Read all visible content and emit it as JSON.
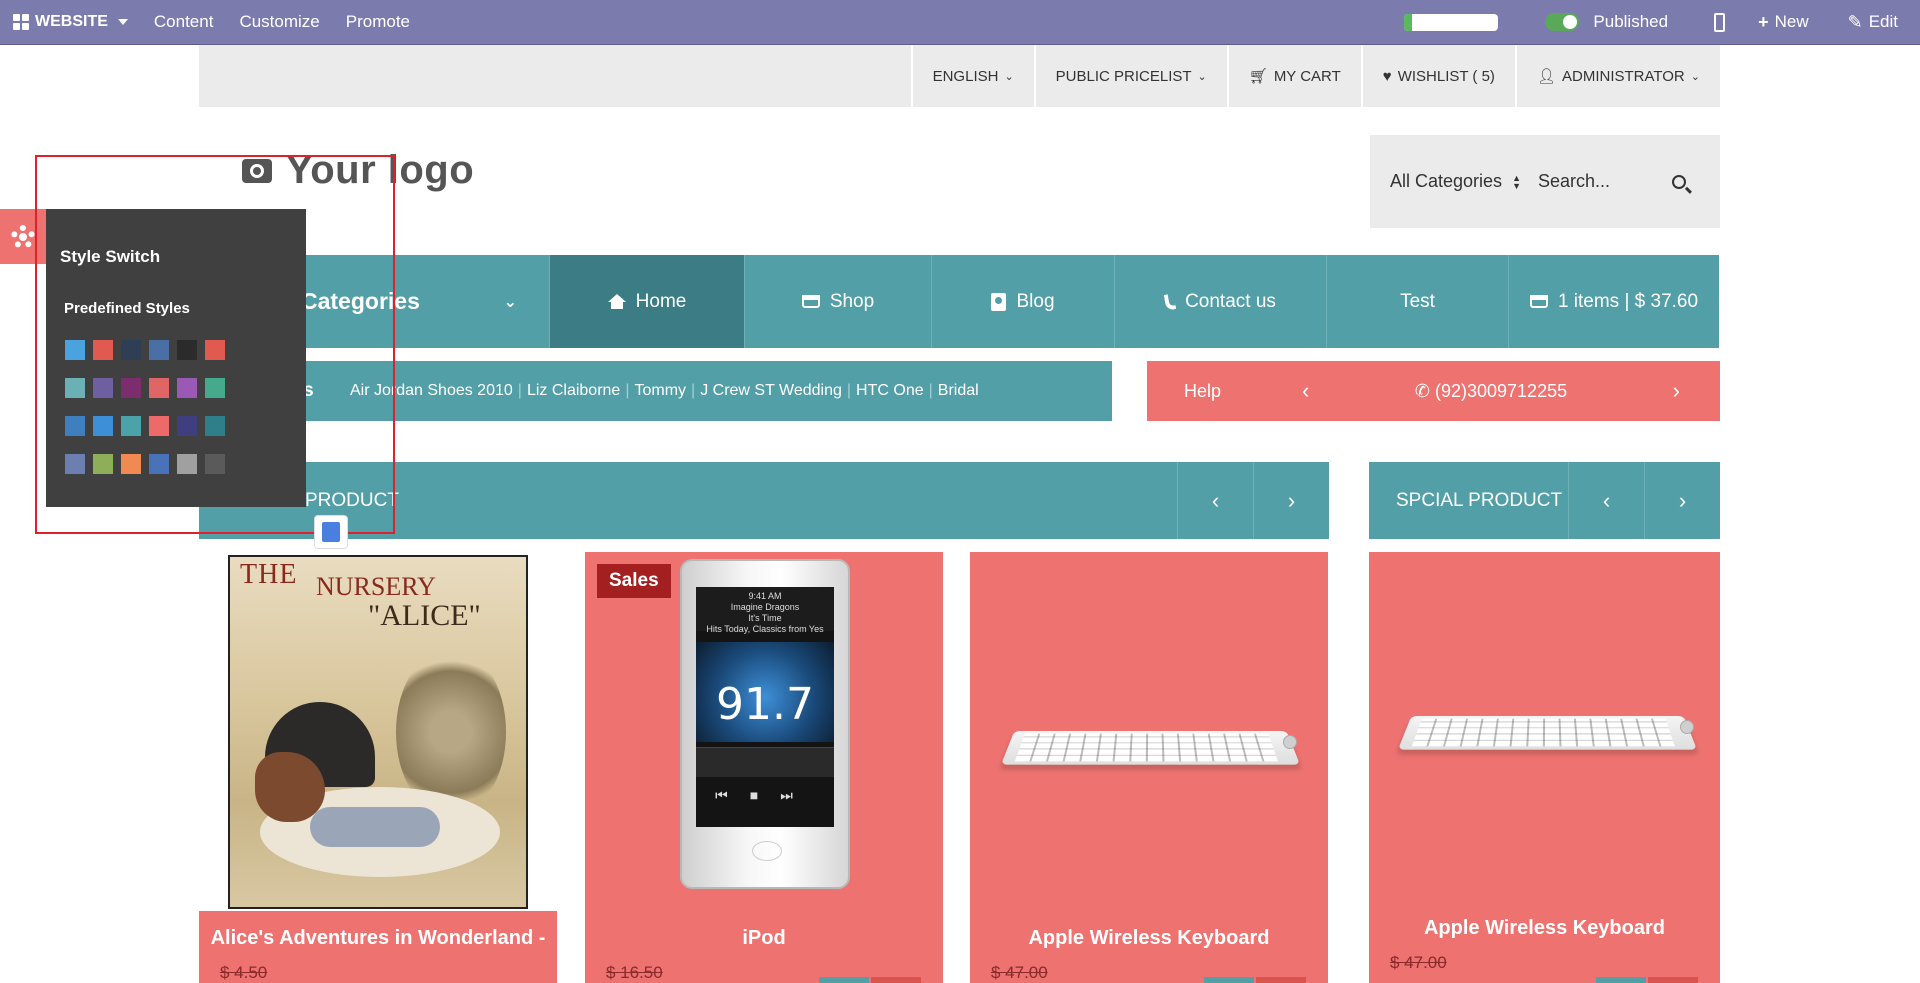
{
  "adminbar": {
    "brand_label": "WEBSITE",
    "items": [
      "Content",
      "Customize",
      "Promote"
    ],
    "progress": 0.08,
    "published_label": "Published",
    "new_label": "New",
    "edit_label": "Edit"
  },
  "topbar": {
    "language": "ENGLISH",
    "pricelist": "PUBLIC PRICELIST",
    "cart": "MY CART",
    "wishlist": "WISHLIST ( 5)",
    "user": "ADMINISTRATOR"
  },
  "logo": {
    "text": "Your logo"
  },
  "search": {
    "category": "All Categories",
    "placeholder": "Search..."
  },
  "mainnav": {
    "categories_label": "Categories",
    "items": [
      "Home",
      "Shop",
      "Blog",
      "Contact us",
      "Test"
    ],
    "cart_summary": "1 items | $ 37.60"
  },
  "brands": {
    "title": "nes",
    "items": [
      "Air Jordan Shoes 2010",
      "Liz Claiborne",
      "Tommy",
      "J Crew ST Wedding",
      "HTC One",
      "Bridal"
    ]
  },
  "help": {
    "label": "Help",
    "phone": "(92)3009712255"
  },
  "sections": {
    "left_title": "PRODUCT",
    "right_title": "SPCIAL PRODUCT"
  },
  "products": [
    {
      "name": "Alice's Adventures in Wonderland -",
      "price": "$ 4.50"
    },
    {
      "name": "iPod",
      "price": "$ 16.50",
      "badge": "Sales"
    },
    {
      "name": "Apple Wireless Keyboard",
      "price": "$ 47.00"
    },
    {
      "name": "Apple Wireless Keyboard",
      "price": "$ 47.00"
    }
  ],
  "book_cover": {
    "line1": "THE",
    "line2": "NURSERY",
    "line3": "\"ALICE\""
  },
  "ipod_screen": {
    "time": "9:41 AM",
    "artist": "Imagine Dragons",
    "song": "It's Time",
    "station": "Hits Today, Classics from Yes",
    "frequency": "91.7"
  },
  "style_switch": {
    "title": "Style Switch",
    "subtitle": "Predefined Styles",
    "swatches": [
      "#4aa3df",
      "#e05a4f",
      "#2e3e55",
      "#4a6fa5",
      "#2b2b2b",
      "#e05a4f",
      "#6bb0b5",
      "#6e5fa0",
      "#7b2d6e",
      "#e06666",
      "#9b59b6",
      "#45a98c",
      "#3f7fbf",
      "#3d8fd8",
      "#4aa3a8",
      "#ee6a6a",
      "#3f3f7f",
      "#2e7f8a",
      "#6b7fb0",
      "#8fae5a",
      "#f08a50",
      "#4a72b8",
      "#a0a0a0",
      "#5a5a5a"
    ]
  },
  "colors": {
    "admin": "#7c7bad",
    "teal": "#539fa8",
    "teal_active": "#3b7c85",
    "coral": "#ed7270"
  }
}
